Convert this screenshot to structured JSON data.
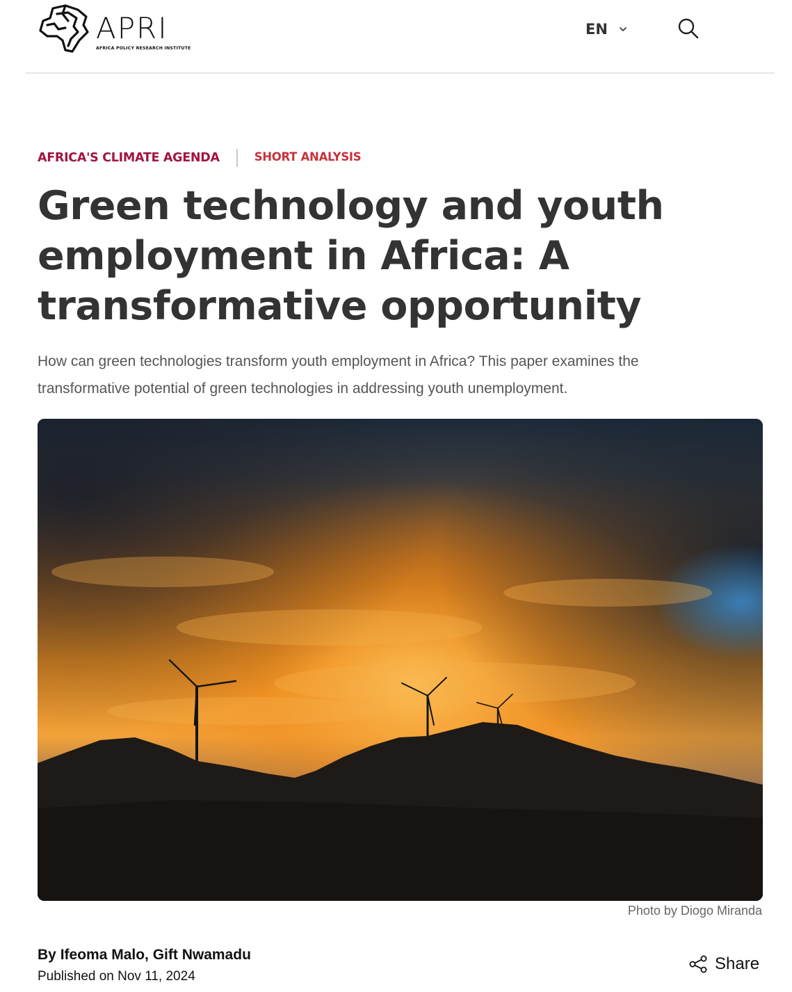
{
  "header": {
    "logo_text": "APRI",
    "logo_subtitle": "AFRICA POLICY RESEARCH INSTITUTE",
    "language": "EN"
  },
  "article": {
    "category": "AFRICA'S CLIMATE AGENDA",
    "type": "SHORT ANALYSIS",
    "title": "Green technology and youth employment in Africa: A transformative opportunity",
    "lead": "How can green technologies transform youth employment in Africa? This paper examines the transformative potential of green technologies in addressing youth unemployment.",
    "photo_credit": "Photo by Diogo Miranda",
    "byline_prefix": "By ",
    "authors": [
      "Ifeoma Malo",
      "Gift Nwamadu"
    ],
    "author_separator": ", ",
    "published": "Published on Nov 11, 2024",
    "share_label": "Share"
  },
  "icons": {
    "logo": "africa-outline-logo-icon",
    "language_toggle": "chevron-down-icon",
    "search": "search-icon",
    "share": "share-icon"
  },
  "colors": {
    "category": "#a0163f",
    "type": "#c8323c",
    "title": "#333333",
    "lead": "#555555",
    "divider": "#e6e6e6"
  }
}
